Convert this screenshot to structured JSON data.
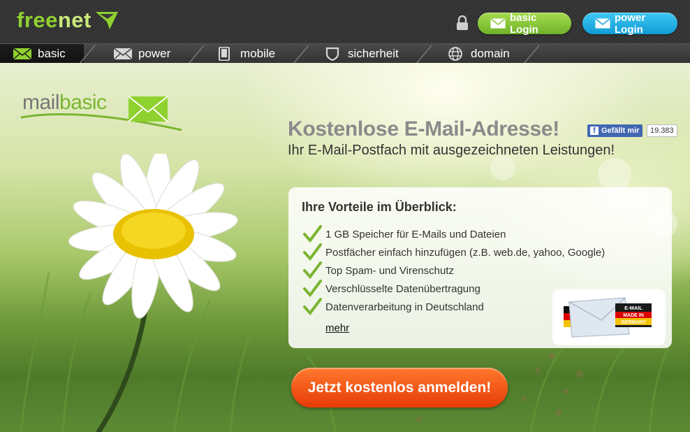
{
  "header": {
    "logo": {
      "part1": "free",
      "part2": "net",
      "icon": "freenet-arrow-icon"
    },
    "lock_icon": "lock-icon",
    "login_basic_label": "basic Login",
    "login_power_label": "power Login"
  },
  "nav": {
    "items": [
      {
        "label": "basic",
        "icon": "envelope-icon",
        "active": true
      },
      {
        "label": "power",
        "icon": "envelope-icon"
      },
      {
        "label": "mobile",
        "icon": "phone-icon"
      },
      {
        "label": "sicherheit",
        "icon": "shield-icon"
      },
      {
        "label": "domain",
        "icon": "globe-icon"
      }
    ]
  },
  "hero": {
    "brand": {
      "part1": "mail",
      "part2": "basic",
      "icon": "envelope-icon"
    },
    "headline": "Kostenlose E-Mail-Adresse!",
    "facebook": {
      "like_label": "Gefällt mir",
      "count": "19.383"
    },
    "subline": "Ihr E-Mail-Postfach mit ausgezeichneten Leistungen!",
    "benefits": {
      "title": "Ihre Vorteile im Überblick:",
      "items": [
        "1 GB Speicher für E-Mails und Dateien",
        "Postfächer einfach hinzufügen (z.B. web.de, yahoo, Google)",
        "Top Spam- und Virenschutz",
        "Verschlüsselte Datenübertragung",
        "Datenverarbeitung in Deutschland"
      ],
      "more_label": "mehr"
    },
    "badge": {
      "line1": "E-MAIL",
      "line2": "MADE IN",
      "line3": "GERMANY"
    },
    "cta_label": "Jetzt kostenlos anmelden!"
  },
  "colors": {
    "brand_green": "#8fd12f",
    "login_basic": "#6fb22a",
    "login_power": "#129bd5",
    "cta_orange": "#e63a06",
    "check_green": "#7ab532"
  }
}
